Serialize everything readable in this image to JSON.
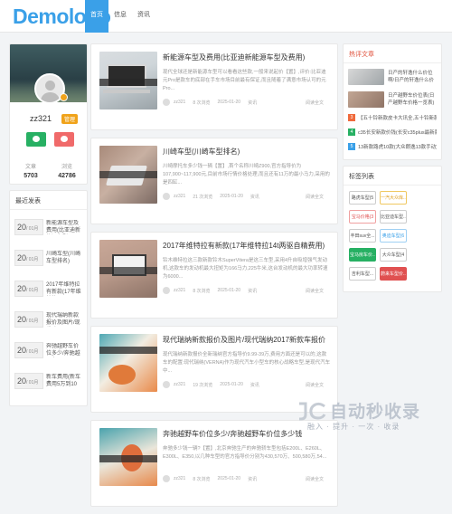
{
  "site": {
    "logo": "Demologo"
  },
  "nav": {
    "items": [
      {
        "label": "首页",
        "active": true
      },
      {
        "label": "信息"
      },
      {
        "label": "资讯"
      }
    ]
  },
  "profile": {
    "name": "zz321",
    "badge": "管理",
    "stats": [
      {
        "label": "文章",
        "value": "5703"
      },
      {
        "label": "浏览",
        "value": "42786"
      }
    ]
  },
  "recent": {
    "title": "最近发表",
    "items": [
      {
        "day": "20",
        "month": "/ 01月",
        "text": "新能源车型及费用(比亚迪新能源车型..."
      },
      {
        "day": "20",
        "month": "/ 01月",
        "text": "川崎车型(川崎车型排名)"
      },
      {
        "day": "20",
        "month": "/ 01月",
        "text": "2017年维特拉有新款(17年维特拉..."
      },
      {
        "day": "20",
        "month": "/ 01月",
        "text": "现代瑞纳新款报价及图片/现代瑞..."
      },
      {
        "day": "20",
        "month": "/ 01月",
        "text": "奔驰越野车价位多少/奔驰越野车..."
      },
      {
        "day": "20",
        "month": "/ 01月",
        "text": "新车费用(新车费用5万到10万)"
      }
    ]
  },
  "posts": [
    {
      "title": "新能源车型及费用(比亚迪新能源车型及费用)",
      "excerpt": "现代全球还是新能源车型可以看看这些款,一般来说起价【置】,评价:比亚迪元Pro是款车的底部在手车市场目前最有保证,而且随着了满意市场认可的元Pro...",
      "author": "zz321",
      "views": "8 次浏览",
      "date": "2025-01-20",
      "cat": "资讯",
      "more": "阅读全文"
    },
    {
      "title": "川崎车型(川崎车型排名)",
      "excerpt": "川崎摩托车多少钱一辆【置】,首个名称川崎Z900,官方指导价为107,900~117,900元,目前市场行情价格处理,而且还有11万的最小马力,采用的是四缸...",
      "author": "zz321",
      "views": "21 次浏览",
      "date": "2025-01-20",
      "cat": "资讯",
      "more": "阅读全文"
    },
    {
      "title": "2017年维特拉有新款(17年维特拉14t两驱自精费用)",
      "excerpt": "铃木维特拉这三款新款铃木SuperVitera是这三车型,采用4升自吸增强气发动机,这款车的发动机最大扭矩为166马力,225牛米,这台发动机的最大功率转速为6000...",
      "author": "zz321",
      "views": "8 次浏览",
      "date": "2025-01-20",
      "cat": "资讯",
      "more": "阅读全文"
    },
    {
      "title": "现代瑞纳新款报价及图片/现代瑞纳2017新款车报价",
      "excerpt": "现代瑞纳新款报价全新瑞纳官方指导价9.99-39万,费用方面还是可以的,这款车的配置:现代瑞纳(VERNA)作为现代汽车小型车的核心战略车型,是现代汽车中...",
      "author": "zz321",
      "views": "19 次浏览",
      "date": "2025-01-20",
      "cat": "资讯",
      "more": "阅读全文"
    },
    {
      "title": "奔驰越野车价位多少/奔驰越野车价位多少钱",
      "excerpt": "奔驰多少钱一辆?【置】,北京奔驰生产的奔驰轿车型包括E200L、E260L、E300L、E350,以几种车型的官方指导价分别为430,570万、500,580万,54...",
      "author": "zz321",
      "views": "8 次浏览",
      "date": "2025-01-20",
      "cat": "资讯",
      "more": "阅读全文"
    }
  ],
  "hot": {
    "title": "热评文章",
    "items": [
      {
        "text": "日产的轩逸什么价位啊/日产的轩逸什么价位啊"
      },
      {
        "text": "日产越野车价位表(日产越野车价格一览表)"
      }
    ],
    "lines": [
      {
        "num": "3",
        "text": "【五十铃新款皮卡大讯全,五十铃新款皮卡】"
      },
      {
        "num": "4",
        "text": "c35长安新款价钱(长安c35plus最新款)"
      },
      {
        "num": "5",
        "text": "13新款路虎10款(大众朗逸13款手动)"
      }
    ]
  },
  "tags": {
    "title": "标签列表",
    "items": [
      "路虎车型(5",
      "一汽大众库...",
      "宝马价格(3",
      "比亚迪车型...",
      "丰田suv全...",
      "奥迪车型(6",
      "宝马房车价...",
      "大众车型(4",
      "吉利车型...",
      "蔚来车型价..."
    ]
  },
  "watermark": {
    "title": "自动秒收录",
    "sub": "融入 · 提升 · 一次 · 收录"
  },
  "colors": {
    "accent": "#3aa0e8",
    "gold": "#f0a31b",
    "wechat": "#27b063",
    "qq": "#f06a6a"
  }
}
